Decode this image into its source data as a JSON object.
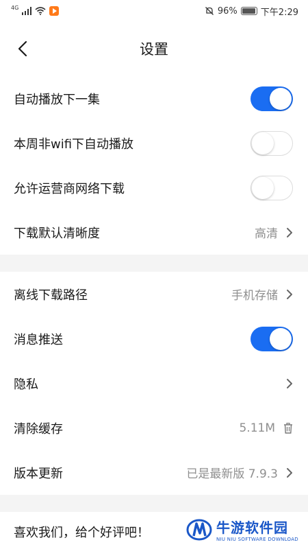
{
  "status_bar": {
    "network": "4G",
    "battery": "96%",
    "time": "下午2:29"
  },
  "header": {
    "title": "设置"
  },
  "settings": {
    "autoplay_next": {
      "label": "自动播放下一集",
      "enabled": true
    },
    "non_wifi_autoplay": {
      "label": "本周非wifi下自动播放",
      "enabled": false
    },
    "allow_carrier_download": {
      "label": "允许运营商网络下载",
      "enabled": false
    },
    "default_download_quality": {
      "label": "下载默认清晰度",
      "value": "高清"
    },
    "offline_download_path": {
      "label": "离线下载路径",
      "value": "手机存储"
    },
    "push_notifications": {
      "label": "消息推送",
      "enabled": true
    },
    "privacy": {
      "label": "隐私"
    },
    "clear_cache": {
      "label": "清除缓存",
      "value": "5.11M"
    },
    "version_update": {
      "label": "版本更新",
      "value": "已是最新版 7.9.3"
    }
  },
  "footer": {
    "rate_prompt": "喜欢我们，给个好评吧！"
  },
  "watermark": {
    "name_cn": "牛游软件园",
    "name_en": "NIU NIU SOFTWARE DOWNLOAD"
  },
  "colors": {
    "accent": "#1a6df2",
    "section_gap": "#f4f4f4",
    "secondary_text": "#8f8f8f"
  }
}
